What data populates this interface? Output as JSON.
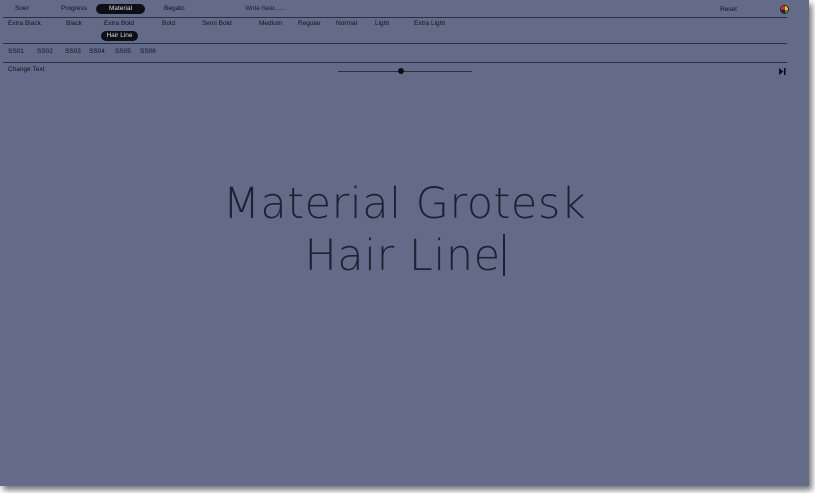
{
  "font_tabs": [
    {
      "label": "Soer",
      "selected": false
    },
    {
      "label": "Progress",
      "selected": false
    },
    {
      "label": "Material",
      "selected": true
    },
    {
      "label": "Begato",
      "selected": false
    }
  ],
  "text_input": {
    "placeholder": "Write hear......"
  },
  "reset_label": "Reset",
  "weights": [
    {
      "label": "Extra Black",
      "selected": false
    },
    {
      "label": "Black",
      "selected": false
    },
    {
      "label": "Extra Bold",
      "selected": false
    },
    {
      "label": "Hair Line",
      "selected": true
    },
    {
      "label": "Bold",
      "selected": false
    },
    {
      "label": "Semi Bold",
      "selected": false
    },
    {
      "label": "Medium",
      "selected": false
    },
    {
      "label": "Regular",
      "selected": false
    },
    {
      "label": "Normal",
      "selected": false
    },
    {
      "label": "Light",
      "selected": false
    },
    {
      "label": "Extra Light",
      "selected": false
    }
  ],
  "stylistic_sets": [
    "SS01",
    "SS02",
    "SS03",
    "SS04",
    "SS05",
    "SS06"
  ],
  "change_text_label": "Change Text",
  "size_slider": {
    "value": 0.47
  },
  "play_icon": "step-forward-icon",
  "logo_icon": "colorwheel-logo-icon",
  "preview": {
    "line1": "Material Grotesk",
    "line2": "Hair Line"
  },
  "colors": {
    "background": "#636b89",
    "text": "#111318",
    "pill": "#0d0f14",
    "preview_text": "#1d2130"
  }
}
